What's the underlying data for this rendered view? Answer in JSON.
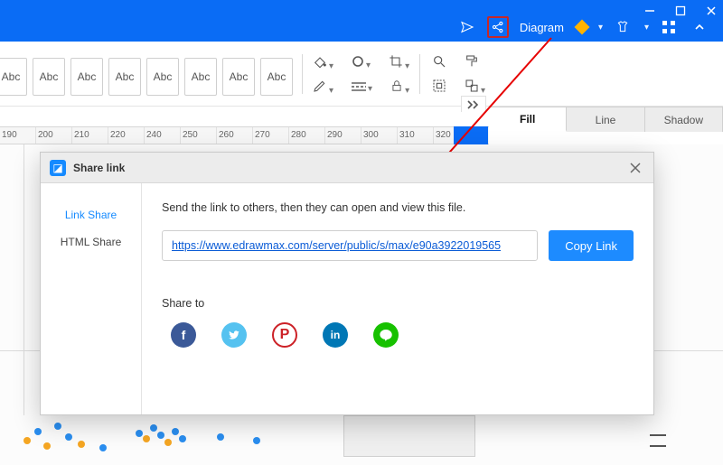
{
  "titlebar": {
    "diagram_label": "Diagram"
  },
  "ribbon": {
    "abc_label": "Abc"
  },
  "right_panel": {
    "tabs": {
      "fill": "Fill",
      "line": "Line",
      "shadow": "Shadow"
    }
  },
  "ruler": {
    "ticks": [
      "190",
      "200",
      "210",
      "220",
      "240",
      "250",
      "260",
      "270",
      "280",
      "290",
      "300",
      "310",
      "320"
    ]
  },
  "dialog": {
    "title": "Share link",
    "side": {
      "link_share": "Link Share",
      "html_share": "HTML Share"
    },
    "description": "Send the link to others, then they can open and view this file.",
    "link_value": "https://www.edrawmax.com/server/public/s/max/e90a3922019565",
    "copy_label": "Copy Link",
    "share_to_label": "Share to",
    "social": {
      "facebook": "f",
      "twitter": "t",
      "pinterest": "P",
      "linkedin": "in",
      "line": "●"
    }
  }
}
